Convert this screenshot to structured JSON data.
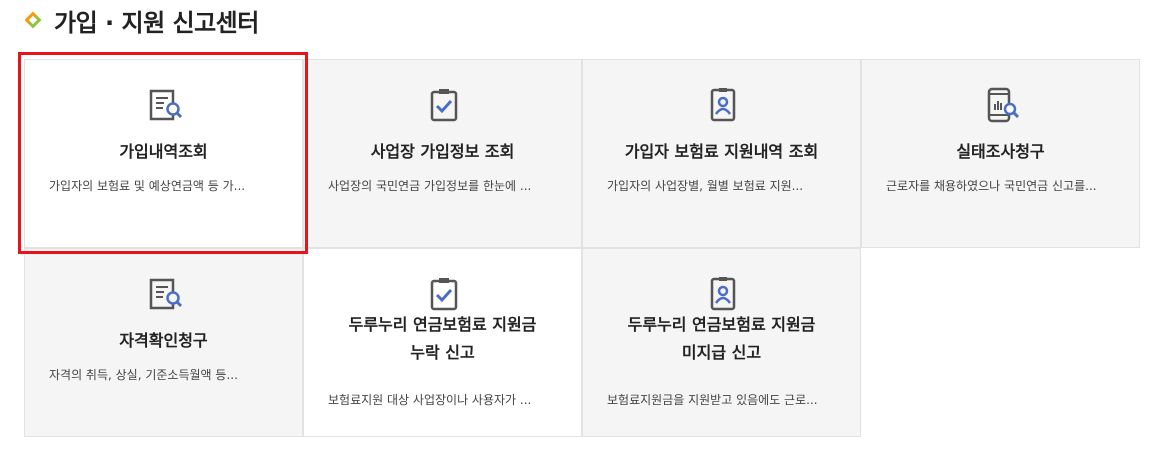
{
  "header": {
    "title": "가입 · 지원 신고센터",
    "icon": "diamond-icon",
    "accent_colors": [
      "#f39c12",
      "#8cc63f"
    ]
  },
  "highlight_color": "#e8141b",
  "cards": [
    {
      "title": "가입내역조회",
      "desc": "가입자의 보험료 및 예상연금액 등 가...",
      "icon": "document-search-icon"
    },
    {
      "title": "사업장 가입정보 조회",
      "desc": "사업장의 국민연금 가입정보를 한눈에 ...",
      "icon": "clipboard-check-icon"
    },
    {
      "title": "가입자 보험료 지원내역 조회",
      "desc": "가입자의 사업장별, 월별 보험료 지원...",
      "icon": "id-card-icon"
    },
    {
      "title": "실태조사청구",
      "desc": "근로자를 채용하였으나 국민연금 신고를...",
      "icon": "mobile-search-icon"
    },
    {
      "title": "자격확인청구",
      "desc": "자격의 취득, 상실, 기준소득월액 등...",
      "icon": "document-search-icon"
    },
    {
      "title_line1": "두루누리 연금보험료 지원금",
      "title_line2": "누락 신고",
      "desc": "보험료지원 대상 사업장이나 사용자가 ...",
      "icon": "clipboard-check-icon"
    },
    {
      "title_line1": "두루누리 연금보험료 지원금",
      "title_line2": "미지급 신고",
      "desc": "보험료지원금을 지원받고 있음에도 근로...",
      "icon": "id-card-icon"
    }
  ]
}
